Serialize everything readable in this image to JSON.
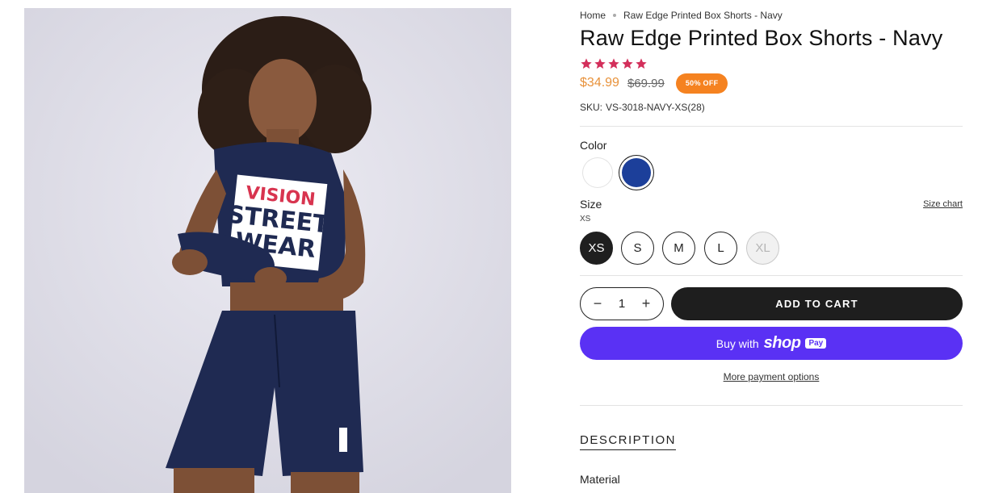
{
  "breadcrumb": {
    "home": "Home",
    "current": "Raw Edge Printed Box Shorts - Navy"
  },
  "product": {
    "title": "Raw Edge Printed Box Shorts - Navy",
    "rating_stars": 5,
    "star_color": "#d32f5b",
    "price_sale": "$34.99",
    "price_compare": "$69.99",
    "discount_badge": "50% OFF",
    "sku_label": "SKU:",
    "sku_value": "VS-3018-NAVY-XS(28)",
    "image_text": {
      "line1": "VISION",
      "line2": "STREET",
      "line3": "WEAR"
    }
  },
  "color": {
    "label": "Color",
    "options": [
      {
        "name": "white",
        "hex": "#ffffff"
      },
      {
        "name": "navy",
        "hex": "#1c3f9a",
        "selected": true
      }
    ]
  },
  "size": {
    "label": "Size",
    "current": "XS",
    "chart_link": "Size chart",
    "options": [
      {
        "label": "XS",
        "state": "selected"
      },
      {
        "label": "S",
        "state": "available"
      },
      {
        "label": "M",
        "state": "available"
      },
      {
        "label": "L",
        "state": "available"
      },
      {
        "label": "XL",
        "state": "unavailable"
      }
    ]
  },
  "cart": {
    "quantity": "1",
    "minus": "−",
    "plus": "+",
    "add_label": "ADD TO CART"
  },
  "shop_pay": {
    "prefix": "Buy with",
    "shop": "shop",
    "pay": "Pay",
    "color": "#5a31f4"
  },
  "more_payment": "More payment options",
  "description": {
    "heading": "DESCRIPTION",
    "first_item": "Material"
  }
}
